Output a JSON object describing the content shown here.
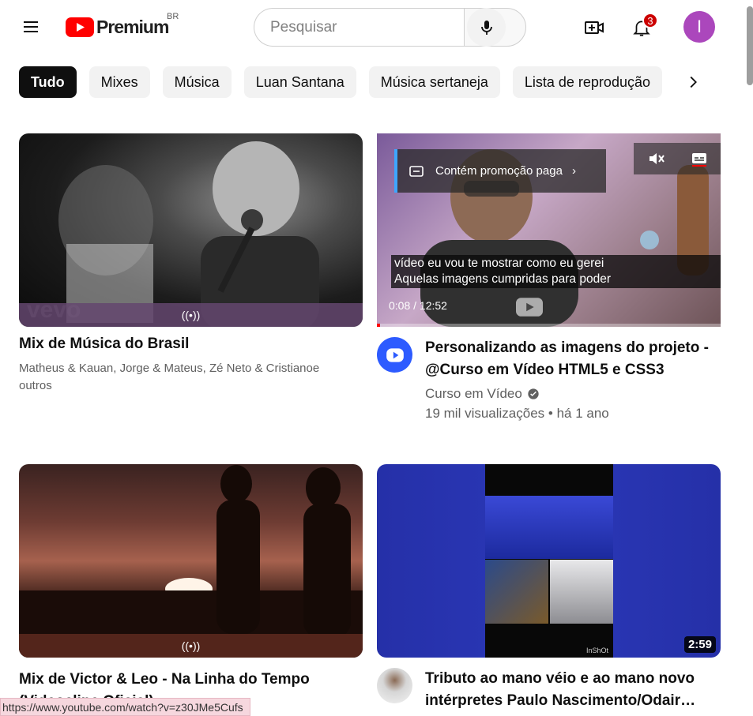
{
  "header": {
    "logo_text": "Premium",
    "country": "BR",
    "search_placeholder": "Pesquisar",
    "notifications_count": "3",
    "avatar_letter": "I"
  },
  "chips": [
    "Tudo",
    "Mixes",
    "Música",
    "Luan Santana",
    "Música sertaneja",
    "Lista de reprodução"
  ],
  "videos": [
    {
      "title": "Mix de Música do Brasil",
      "subtitle": "Matheus & Kauan, Jorge & Mateus, Zé Neto & Cristianoe outros",
      "mix_icon": "((•))",
      "watermark": "vevo"
    },
    {
      "title": "Personalizando as imagens do projeto - @Curso em Vídeo HTML5 e CSS3",
      "channel": "Curso em Vídeo",
      "stats": "19 mil visualizações • há 1 ano",
      "promo_label": "Contém promoção paga",
      "caption_line1": "vídeo eu vou te mostrar como eu gerei",
      "caption_line2": "Aquelas imagens cumpridas para poder",
      "time": "0:08 / 12:52",
      "progress": 0.01
    },
    {
      "title": "Mix de Victor & Leo - Na Linha do Tempo (Videoclipe Oficial)",
      "mix_icon": "((•))"
    },
    {
      "title": "Tributo ao mano véio e ao mano novo intérpretes Paulo Nascimento/Odair…",
      "duration": "2:59",
      "watermark": "InShOt"
    }
  ],
  "status_bar": {
    "url": "https://www.youtube.com/watch?v=z30JMe5Cufs"
  },
  "colors": {
    "brand_red": "#ff0000",
    "avatar_purple": "#ab47bc",
    "badge_red": "#cc0000",
    "chip_active": "#0f0f0f"
  }
}
